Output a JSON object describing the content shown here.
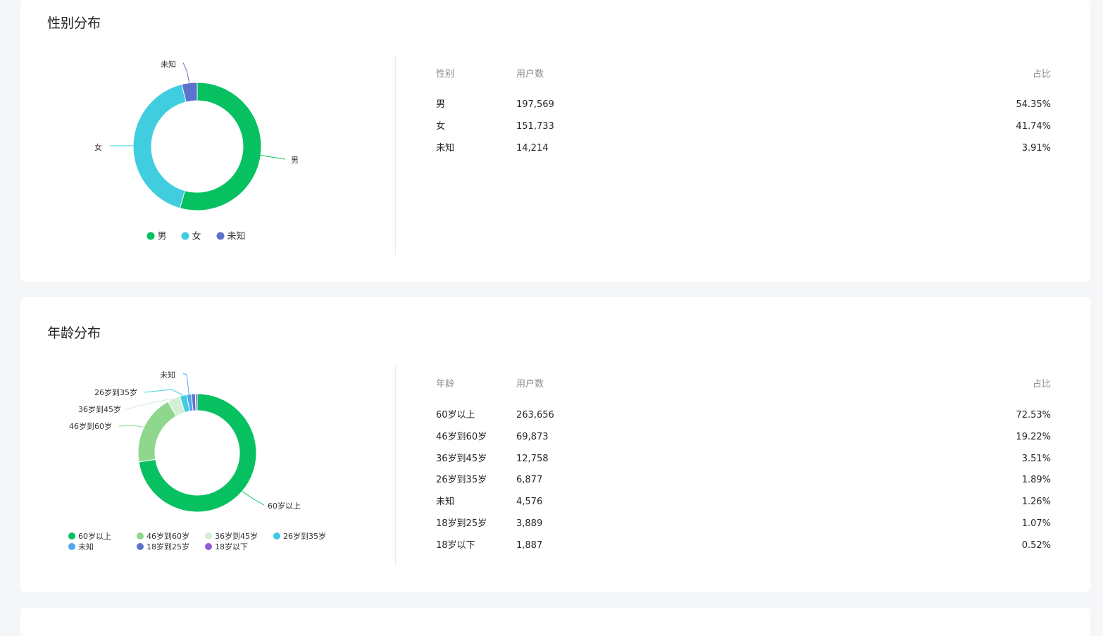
{
  "gender": {
    "title": "性别分布",
    "table_headers": [
      "性别",
      "用户数",
      "占比"
    ],
    "rows": [
      {
        "label": "男",
        "count": "197,569",
        "pct": "54.35%"
      },
      {
        "label": "女",
        "count": "151,733",
        "pct": "41.74%"
      },
      {
        "label": "未知",
        "count": "14,214",
        "pct": "3.91%"
      }
    ]
  },
  "age": {
    "title": "年龄分布",
    "table_headers": [
      "年龄",
      "用户数",
      "占比"
    ],
    "rows": [
      {
        "label": "60岁以上",
        "count": "263,656",
        "pct": "72.53%"
      },
      {
        "label": "46岁到60岁",
        "count": "69,873",
        "pct": "19.22%"
      },
      {
        "label": "36岁到45岁",
        "count": "12,758",
        "pct": "3.51%"
      },
      {
        "label": "26岁到35岁",
        "count": "6,877",
        "pct": "1.89%"
      },
      {
        "label": "未知",
        "count": "4,576",
        "pct": "1.26%"
      },
      {
        "label": "18岁到25岁",
        "count": "3,889",
        "pct": "1.07%"
      },
      {
        "label": "18岁以下",
        "count": "1,887",
        "pct": "0.52%"
      }
    ]
  },
  "chart_data": [
    {
      "type": "pie",
      "donut": true,
      "categories": [
        "男",
        "女",
        "未知"
      ],
      "values": [
        197569,
        151733,
        14214
      ],
      "colors": [
        "#07c160",
        "#40cde0",
        "#5c73ce"
      ],
      "slice_labels": [
        "男",
        "女",
        "未知"
      ],
      "legend": [
        "男",
        "女",
        "未知"
      ],
      "legend_position": "bottom"
    },
    {
      "type": "pie",
      "donut": true,
      "categories": [
        "60岁以上",
        "46岁到60岁",
        "36岁到45岁",
        "26岁到35岁",
        "未知",
        "18岁到25岁",
        "18岁以下"
      ],
      "values": [
        263656,
        69873,
        12758,
        6877,
        4576,
        3889,
        1887
      ],
      "colors": [
        "#07c160",
        "#8fd78d",
        "#d3efd3",
        "#40cde0",
        "#53a7f0",
        "#5c73ce",
        "#8f5cd6"
      ],
      "slice_labels": [
        "60岁以上",
        "46岁到60岁",
        "36岁到45岁",
        "26岁到35岁",
        "未知"
      ],
      "legend": [
        "60岁以上",
        "46岁到60岁",
        "36岁到45岁",
        "26岁到35岁",
        "未知",
        "18岁到25岁",
        "18岁以下"
      ],
      "legend_position": "bottom"
    }
  ]
}
